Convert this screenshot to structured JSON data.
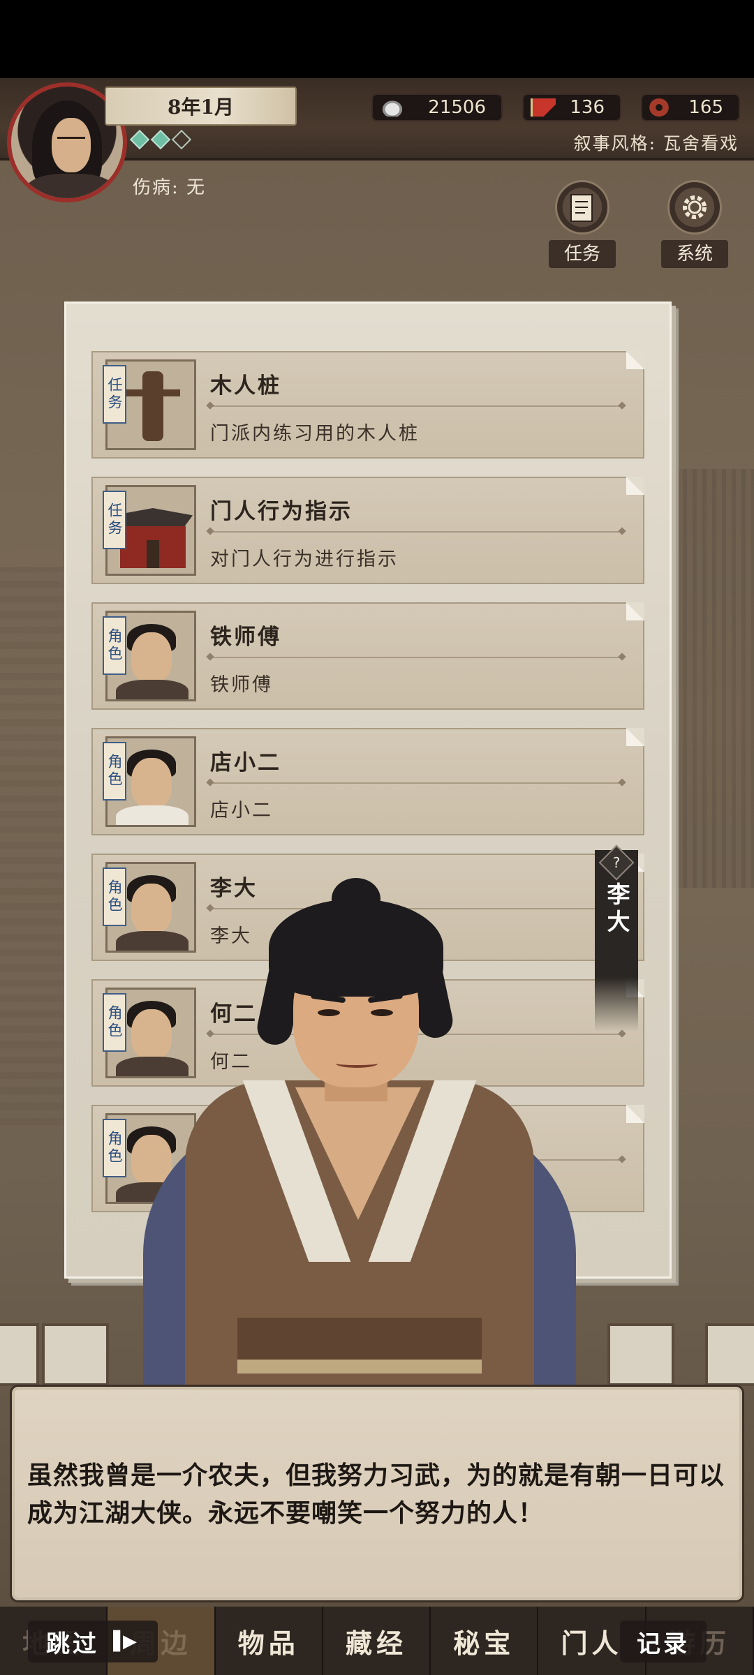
{
  "header": {
    "date": "8年1月",
    "injury_label": "伤病:",
    "injury_value": "无",
    "rank_diamonds": [
      true,
      true,
      false
    ],
    "narrative_label": "叙事风格:",
    "narrative_value": "瓦舍看戏",
    "resources": [
      {
        "icon": "silver-ingot-icon",
        "value": "21506"
      },
      {
        "icon": "red-flag-icon",
        "value": "136"
      },
      {
        "icon": "coin-icon",
        "value": "165"
      }
    ],
    "buttons": [
      {
        "icon": "scroll-icon",
        "label": "任务"
      },
      {
        "icon": "gear-icon",
        "label": "系统"
      }
    ]
  },
  "cards": [
    {
      "tag": "任务",
      "title": "木人桩",
      "desc": "门派内练习用的木人桩",
      "thumb": "wooden-dummy"
    },
    {
      "tag": "任务",
      "title": "门人行为指示",
      "desc": "对门人行为进行指示",
      "thumb": "hall"
    },
    {
      "tag": "角色",
      "title": "铁师傅",
      "desc": "铁师傅",
      "thumb": "portrait"
    },
    {
      "tag": "角色",
      "title": "店小二",
      "desc": "店小二",
      "thumb": "portrait"
    },
    {
      "tag": "角色",
      "title": "李大",
      "desc": "李大",
      "thumb": "portrait"
    },
    {
      "tag": "角色",
      "title": "何二",
      "desc": "何二",
      "thumb": "portrait"
    },
    {
      "tag": "角色",
      "title": "",
      "desc": "",
      "thumb": "portrait"
    }
  ],
  "speaker": {
    "name": "李大",
    "help": "?"
  },
  "dialog": {
    "text": "虽然我曾是一介农夫，但我努力习武，为的就是有朝一日可以成为江湖大侠。永远不要嘲笑一个努力的人！"
  },
  "tabs": [
    "地图",
    "周边",
    "物品",
    "藏经",
    "秘宝",
    "门人",
    "游历"
  ],
  "controls": {
    "skip": "跳过",
    "record": "记录"
  },
  "colors": {
    "accent_red": "#9c2f2a",
    "tag_blue": "#2d4f7f",
    "diamond_teal": "#6fbfa5"
  }
}
